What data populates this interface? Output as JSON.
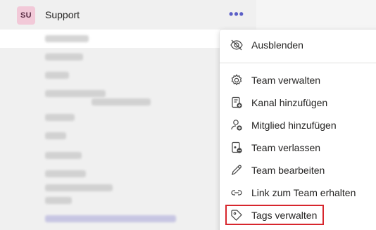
{
  "team": {
    "initials": "SU",
    "name": "Support",
    "avatar_color": "#f2c9d8",
    "more_label": "•••"
  },
  "channels": {
    "note": "",
    "count_visible": 11
  },
  "menu": {
    "items": [
      {
        "label": "Ausblenden",
        "icon": "hide-eye-icon"
      },
      {
        "label": "Team verwalten",
        "icon": "gear-icon"
      },
      {
        "label": "Kanal hinzufügen",
        "icon": "add-channel-icon"
      },
      {
        "label": "Mitglied hinzufügen",
        "icon": "add-member-icon"
      },
      {
        "label": "Team verlassen",
        "icon": "leave-team-icon"
      },
      {
        "label": "Team bearbeiten",
        "icon": "pencil-icon"
      },
      {
        "label": "Link zum Team erhalten",
        "icon": "link-icon"
      },
      {
        "label": "Tags verwalten",
        "icon": "tag-icon"
      }
    ]
  },
  "colors": {
    "accent": "#5b5fc7",
    "highlight_border": "#d7262d"
  }
}
